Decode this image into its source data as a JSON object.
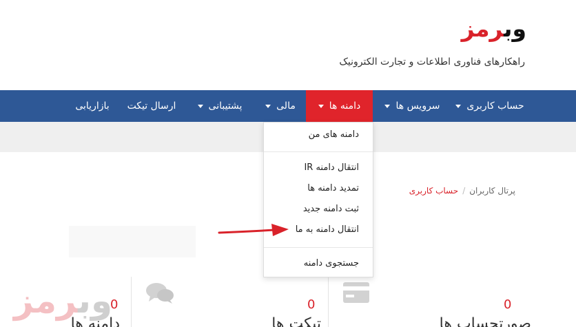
{
  "header": {
    "logo_part1": "وب",
    "logo_part2": "رمز",
    "tagline": "راهکارهای فناوری اطلاعات و تجارت الکترونیک"
  },
  "nav": {
    "items": [
      {
        "label": "حساب کاربری",
        "has_caret": true
      },
      {
        "label": "سرویس ها",
        "has_caret": true
      },
      {
        "label": "دامنه ها",
        "has_caret": true,
        "active": true
      },
      {
        "label": "مالی",
        "has_caret": true
      },
      {
        "label": "پشتیبانی",
        "has_caret": true
      },
      {
        "label": "ارسال تیکت",
        "has_caret": false
      },
      {
        "label": "بازاریابی",
        "has_caret": false
      }
    ]
  },
  "dropdown": {
    "items": [
      "دامنه های من",
      "انتقال دامنه IR",
      "تمدید دامنه ها",
      "ثبت دامنه جدید",
      "انتقال دامنه به ما",
      "جستجوی دامنه"
    ]
  },
  "breadcrumb": {
    "home": "پرتال کاربران",
    "separator": "/",
    "current": "حساب کاربری"
  },
  "stats": [
    {
      "value": "0",
      "label": "صورتحساب ها",
      "icon": "credit-card-icon"
    },
    {
      "value": "0",
      "label": "تیکت ها",
      "icon": "comments-icon"
    },
    {
      "value": "0",
      "label": "دامنه ها",
      "icon": "globe-icon"
    }
  ],
  "watermark": {
    "part1": "وب",
    "part2": "رمز"
  },
  "colors": {
    "brand_red": "#e0242b",
    "nav_blue": "#2e5896",
    "band_grey": "#efefef"
  }
}
